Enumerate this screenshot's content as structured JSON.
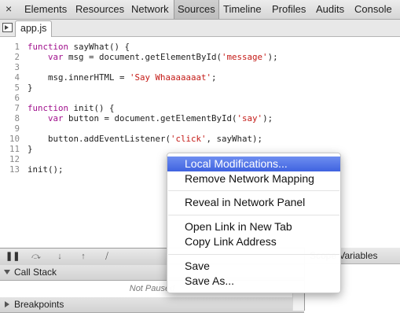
{
  "toolbar": {
    "close": "×",
    "tabs": [
      "Elements",
      "Resources",
      "Network",
      "Sources",
      "Timeline",
      "Profiles",
      "Audits",
      "Console"
    ],
    "selected": "Sources"
  },
  "file_tab": "app.js",
  "code": [
    {
      "n": "1",
      "t": ""
    },
    {
      "n": "2",
      "t": ""
    },
    {
      "n": "3",
      "t": ""
    },
    {
      "n": "4",
      "t": ""
    },
    {
      "n": "5",
      "t": ""
    },
    {
      "n": "6",
      "t": ""
    },
    {
      "n": "7",
      "t": ""
    },
    {
      "n": "8",
      "t": ""
    },
    {
      "n": "9",
      "t": ""
    },
    {
      "n": "10",
      "t": ""
    },
    {
      "n": "11",
      "t": ""
    },
    {
      "n": "12",
      "t": ""
    },
    {
      "n": "13",
      "t": ""
    }
  ],
  "code_html": [
    "<span class=\"kw\">function</span> sayWhat() {",
    "    <span class=\"kw\">var</span> msg = document.getElementById(<span class=\"str\">'message'</span>);",
    "",
    "    msg.innerHTML = <span class=\"str\">'Say Whaaaaaaat'</span>;",
    "}",
    "",
    "<span class=\"kw\">function</span> init() {",
    "    <span class=\"kw\">var</span> button = document.getElementById(<span class=\"str\">'say'</span>);",
    "",
    "    button.addEventListener(<span class=\"str\">'click'</span>, sayWhat);",
    "}",
    "",
    "init();"
  ],
  "debugger": {
    "call_stack": "Call Stack",
    "not_paused": "Not Paused",
    "breakpoints": "Breakpoints",
    "scope_variables": "Scope Variables"
  },
  "context_menu": {
    "items": [
      "Local Modifications...",
      "Remove Network Mapping",
      "Reveal in Network Panel",
      "Open Link in New Tab",
      "Copy Link Address",
      "Save",
      "Save As..."
    ],
    "highlighted": "Local Modifications..."
  }
}
